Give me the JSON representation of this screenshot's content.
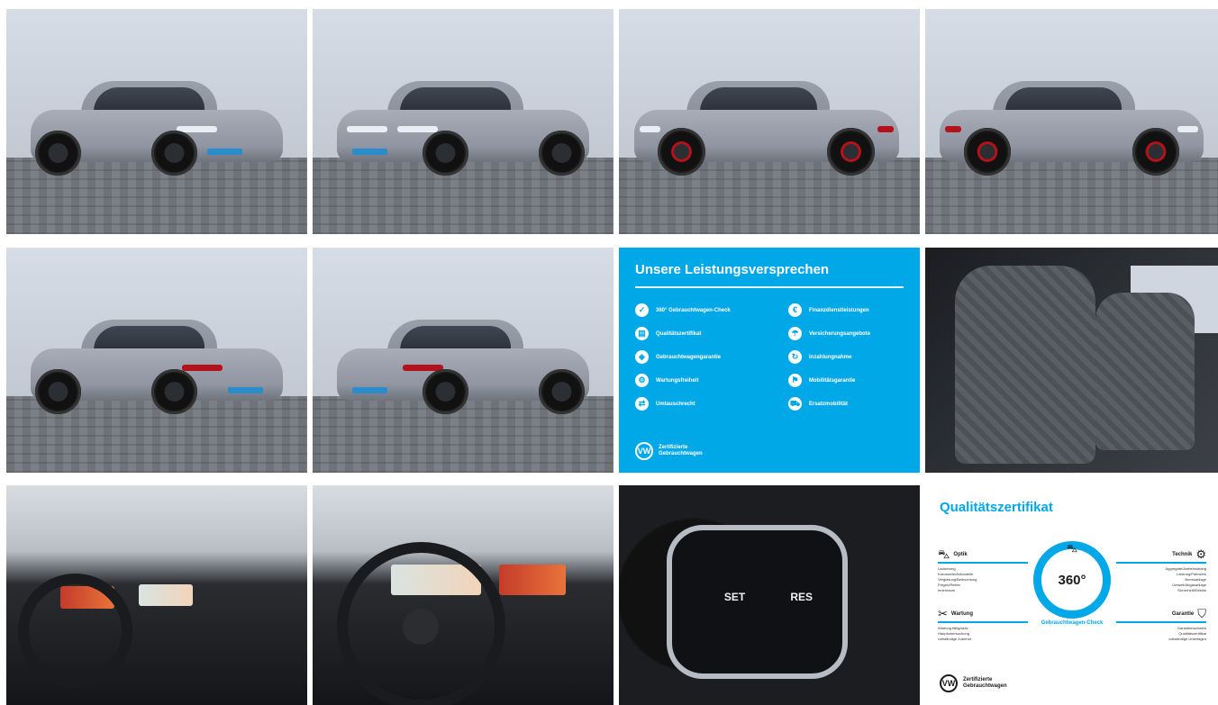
{
  "gallery": {
    "tiles": [
      {
        "id": "front-left",
        "kind": "photo"
      },
      {
        "id": "front-right",
        "kind": "photo"
      },
      {
        "id": "side-left",
        "kind": "photo"
      },
      {
        "id": "side-right",
        "kind": "photo"
      },
      {
        "id": "rear-left",
        "kind": "photo"
      },
      {
        "id": "rear-right",
        "kind": "photo"
      },
      {
        "id": "promises",
        "kind": "info"
      },
      {
        "id": "front-seats",
        "kind": "photo"
      },
      {
        "id": "cockpit",
        "kind": "photo"
      },
      {
        "id": "instrument-cluster",
        "kind": "photo"
      },
      {
        "id": "steering-wheel-buttons",
        "kind": "photo"
      },
      {
        "id": "certificate",
        "kind": "info"
      }
    ]
  },
  "promises": {
    "title": "Unsere Leistungsversprechen",
    "left_items": [
      {
        "label": "360° Gebrauchtwagen-Check",
        "icon": "check-icon"
      },
      {
        "label": "Qualitätszertifikat",
        "icon": "certificate-icon"
      },
      {
        "label": "Gebrauchtwagengarantie",
        "icon": "shield-icon"
      },
      {
        "label": "Wartungsfreiheit",
        "icon": "wrench-icon"
      },
      {
        "label": "Umtauschrecht",
        "icon": "exchange-icon"
      }
    ],
    "right_items": [
      {
        "label": "Finanzdienstleistungen",
        "icon": "finance-icon"
      },
      {
        "label": "Versicherungsangebote",
        "icon": "insurance-icon"
      },
      {
        "label": "Inzahlungnahme",
        "icon": "trade-in-icon"
      },
      {
        "label": "Mobilitätsgarantie",
        "icon": "mobility-icon"
      },
      {
        "label": "Ersatzmobilität",
        "icon": "replacement-car-icon"
      }
    ],
    "brand_line1": "Zertifizierte",
    "brand_line2": "Gebrauchtwagen",
    "brand_logo": "VW"
  },
  "certificate": {
    "title": "Qualitätszertifikat",
    "center_value": "360°",
    "center_label": "Gebrauchtwagen-Check",
    "optik": {
      "label": "Optik",
      "items": [
        "Lackierung",
        "Karosserie/Anbauteile",
        "Verglasung/Beleuchtung",
        "Felgen/Reifen",
        "Innenraum"
      ]
    },
    "technik": {
      "label": "Technik",
      "items": [
        "Aggregate/Antriebsstrang",
        "Leistung/Fahrwerk",
        "Bremsanlage",
        "Umwelt/Abgasanlage",
        "Sicherheit/Elektrik"
      ]
    },
    "wartung": {
      "label": "Wartung",
      "items": [
        "Wartung fällig/aktiv",
        "Hauptuntersuchung",
        "vollständige Zubehör"
      ]
    },
    "garantie": {
      "label": "Garantie",
      "items": [
        "Garantienachweis",
        "Qualitätszertifikat",
        "vollständige Unterlagen"
      ]
    },
    "brand_line1": "Zertifizierte",
    "brand_line2": "Gebrauchtwagen",
    "brand_logo": "VW"
  },
  "steering": {
    "left_button": "SET",
    "right_button": "RES"
  },
  "colors": {
    "vw_blue": "#00a8e8",
    "car_grey": "#9aa0ab",
    "gti_red": "#b3121b"
  }
}
